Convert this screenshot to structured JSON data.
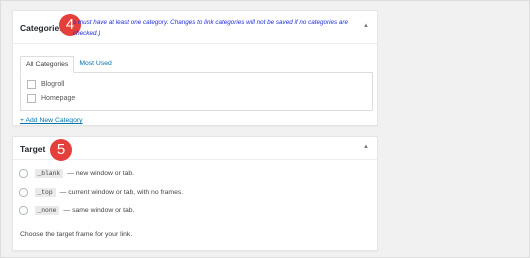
{
  "categories": {
    "title": "Categories",
    "badge": "4",
    "note": "You must have at least one category. Changes to link categories will not be saved if no categories are checked.)",
    "note_visible_start": "s must have at least one category. Changes to link categories will not be saved if no categories are",
    "note_visible_end": "checked.)",
    "tabs": [
      "All Categories",
      "Most Used"
    ],
    "items": [
      {
        "label": "Blogroll",
        "checked": false
      },
      {
        "label": "Homepage",
        "checked": false
      }
    ],
    "add_link": "+ Add New Category"
  },
  "target": {
    "title": "Target",
    "badge": "5",
    "options": [
      {
        "code": "_blank",
        "desc": "— new window or tab."
      },
      {
        "code": "_top",
        "desc": "— current window or tab, with no frames."
      },
      {
        "code": "_none",
        "desc": "— same window or tab."
      }
    ],
    "help": "Choose the target frame for your link."
  },
  "colors": {
    "badge": "#e43f3a",
    "link": "#0073aa",
    "note": "#1f2fd6"
  }
}
